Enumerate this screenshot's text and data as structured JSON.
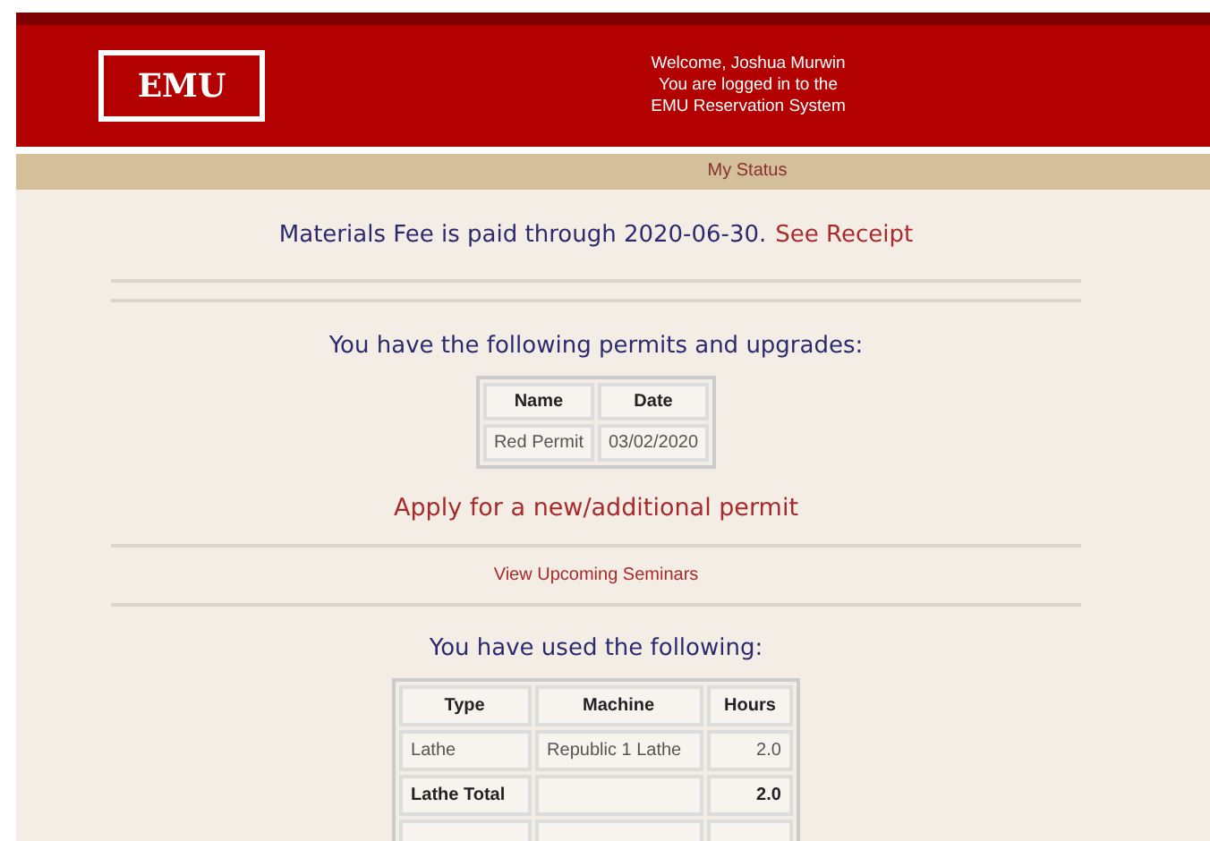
{
  "header": {
    "logo": "EMU",
    "welcome_lines": [
      "Welcome, Joshua Murwin",
      "You are logged in to the",
      "EMU Reservation System"
    ]
  },
  "nav": {
    "items": [
      {
        "label": "My Status"
      }
    ]
  },
  "fee": {
    "text": "Materials Fee is paid through 2020-06-30.",
    "link": "See Receipt"
  },
  "permits": {
    "heading": "You have the following permits and upgrades:",
    "columns": [
      "Name",
      "Date"
    ],
    "rows": [
      [
        "Red Permit",
        "03/02/2020"
      ]
    ],
    "apply_link": "Apply for a new/additional permit"
  },
  "seminars_link": "View Upcoming Seminars",
  "usage": {
    "heading": "You have used the following:",
    "columns": [
      "Type",
      "Machine",
      "Hours"
    ],
    "rows": [
      {
        "kind": "item",
        "cells": [
          "Lathe",
          "Republic 1 Lathe",
          "2.0"
        ]
      },
      {
        "kind": "total",
        "cells": [
          "Lathe Total",
          "",
          "2.0"
        ]
      }
    ]
  }
}
